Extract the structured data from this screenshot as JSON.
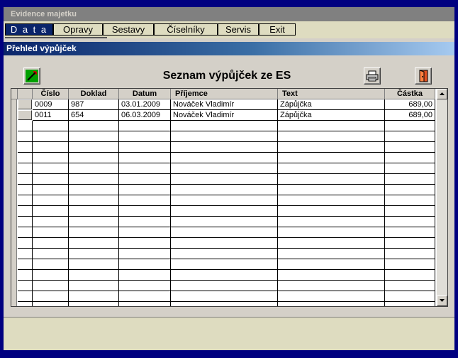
{
  "app": {
    "title": "Evidence majetku"
  },
  "menu": {
    "items": [
      {
        "label": "D a t a",
        "active": true
      },
      {
        "label": "Opravy"
      },
      {
        "label": "Sestavy"
      },
      {
        "label": "Číselníky"
      },
      {
        "label": "Servis"
      },
      {
        "label": "Exit"
      }
    ]
  },
  "window": {
    "title": "Přehled výpůjček",
    "heading": "Seznam výpůjček ze ES"
  },
  "toolbar": {
    "icons": [
      "edit-icon",
      "printer-icon",
      "exit-door-icon"
    ]
  },
  "grid": {
    "columns": [
      "Číslo",
      "Doklad",
      "Datum",
      "Příjemce",
      "Text",
      "Částka"
    ],
    "rows": [
      [
        "0009",
        "987",
        "03.01.2009",
        "Nováček Vladimír",
        "Zápůjčka",
        "689,00"
      ],
      [
        "0011",
        "654",
        "06.03.2009",
        "Nováček Vladimír",
        "Zápůjčka",
        "689,00"
      ]
    ],
    "empty_rows": 18
  },
  "colors": {
    "desktop": "#000080",
    "face": "#d4d0c8",
    "active_menu": "#0a246a"
  }
}
